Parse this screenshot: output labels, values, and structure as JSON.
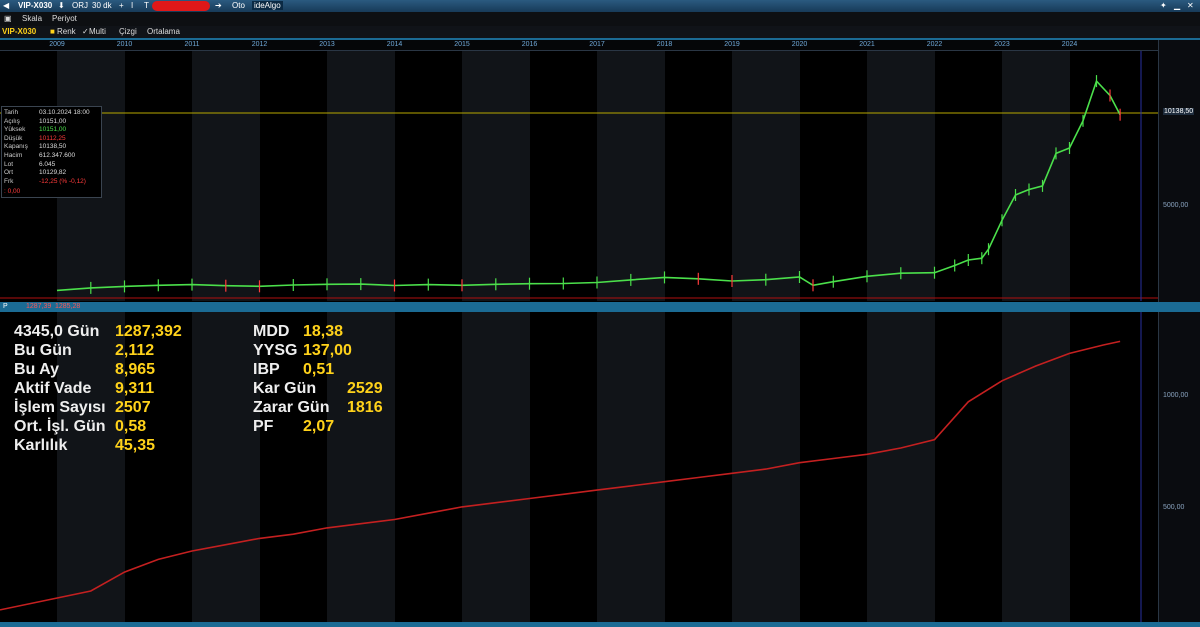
{
  "toolbar": {
    "symbol": "VIP-X030",
    "orj": "ORJ",
    "interval": "30 dk",
    "plus": "+",
    "bar": "I",
    "t": "T",
    "oto": "Oto",
    "brand": "ideAlgo",
    "menu": [
      "Skala",
      "Periyot"
    ]
  },
  "chart_toolbar": {
    "symbol_tag": "VIP-X030",
    "renk": "Renk",
    "multi": "Multi",
    "cizgi": "Çizgi",
    "ortalama": "Ortalama"
  },
  "years": [
    "2009",
    "2010",
    "2011",
    "2012",
    "2013",
    "2014",
    "2015",
    "2016",
    "2017",
    "2018",
    "2019",
    "2020",
    "2021",
    "2022",
    "2023",
    "2024"
  ],
  "info": {
    "rows": [
      {
        "k": "Tarih",
        "v": "03.10.2024 18:00",
        "c": "#ddd"
      },
      {
        "k": "Açılış",
        "v": "10151,00",
        "c": "#ddd"
      },
      {
        "k": "Yüksek",
        "v": "10151,00",
        "c": "#4be04b"
      },
      {
        "k": "Düşük",
        "v": "10112,25",
        "c": "#ff3b3b"
      },
      {
        "k": "Kapanış",
        "v": "10138,50",
        "c": "#ddd"
      },
      {
        "k": "Hacim",
        "v": "612.347.600",
        "c": "#ddd"
      },
      {
        "k": "Lot",
        "v": "6.045",
        "c": "#ddd"
      },
      {
        "k": "Ort",
        "v": "10129,82",
        "c": "#ddd"
      },
      {
        "k": "Frk",
        "v": "-12,25 (% -0,12)",
        "c": "#ff3b3b"
      }
    ],
    "footer": ": 0,00"
  },
  "price_axis": {
    "current": "10138,50",
    "tick": "5000,00"
  },
  "equity_axis": {
    "ticks": [
      "1000,00",
      "500,00"
    ]
  },
  "equity_strip": {
    "label": "P",
    "v1": "1287,39",
    "v2": "1285,28"
  },
  "stats": {
    "left": [
      {
        "label": "4345,0 Gün",
        "value": "1287,392"
      },
      {
        "label": "Bu Gün",
        "value": "2,112"
      },
      {
        "label": "Bu Ay",
        "value": "8,965"
      },
      {
        "label": "Aktif Vade",
        "value": "9,311"
      },
      {
        "label": "İşlem Sayısı",
        "value": "2507"
      },
      {
        "label": "Ort. İşl. Gün",
        "value": "0,58"
      },
      {
        "label": "Karlılık",
        "value": "45,35"
      }
    ],
    "right": [
      {
        "label": "MDD",
        "value": "18,38"
      },
      {
        "label": "YYSG",
        "value": "137,00"
      },
      {
        "label": "IBP",
        "value": "0,51"
      },
      {
        "label": "Kar Gün",
        "value": "2529"
      },
      {
        "label": "Zarar Gün",
        "value": "1816"
      },
      {
        "label": "PF",
        "value": "2,07"
      }
    ]
  },
  "colors": {
    "up": "#4be04b",
    "down": "#ff3b3b",
    "equity": "#c42020",
    "accent": "#1b6b94",
    "stat_value": "#ffd21a"
  },
  "chart_data": [
    {
      "type": "line",
      "series": [
        {
          "x": [
            2009.0,
            2009.5,
            2010.0,
            2010.5,
            2011.0,
            2011.5,
            2012.0,
            2012.5,
            2013.0,
            2013.5,
            2014.0,
            2014.5,
            2015.0,
            2015.5,
            2016.0,
            2016.5,
            2017.0,
            2017.5,
            2018.0,
            2018.5,
            2019.0,
            2019.5,
            2020.0,
            2020.2,
            2020.5,
            2021.0,
            2021.5,
            2022.0,
            2022.3,
            2022.5,
            2022.7,
            2022.8,
            2023.0,
            2023.2,
            2023.4,
            2023.6,
            2023.8,
            2024.0,
            2024.2,
            2024.4,
            2024.6,
            2024.75
          ],
          "values": [
            420,
            560,
            640,
            700,
            740,
            680,
            650,
            720,
            760,
            770,
            690,
            740,
            700,
            760,
            790,
            800,
            860,
            1000,
            1140,
            1060,
            940,
            1010,
            1160,
            700,
            900,
            1200,
            1370,
            1400,
            1800,
            2100,
            2200,
            2700,
            4300,
            5700,
            6000,
            6200,
            8000,
            8300,
            9800,
            12000,
            11200,
            10138
          ]
        }
      ],
      "ylim": [
        0,
        13000
      ]
    },
    {
      "type": "line",
      "series": [
        {
          "x": [
            2009.0,
            2009.5,
            2010.0,
            2010.5,
            2011.0,
            2011.5,
            2012.0,
            2012.5,
            2013.0,
            2013.5,
            2014.0,
            2014.5,
            2015.0,
            2015.5,
            2016.0,
            2016.5,
            2017.0,
            2017.5,
            2018.0,
            2018.5,
            2019.0,
            2019.5,
            2020.0,
            2020.5,
            2021.0,
            2021.5,
            2022.0,
            2022.5,
            2023.0,
            2023.5,
            2024.0,
            2024.5,
            2024.75
          ],
          "values": [
            10,
            100,
            190,
            250,
            290,
            320,
            350,
            370,
            400,
            420,
            440,
            470,
            500,
            520,
            540,
            560,
            580,
            600,
            620,
            640,
            660,
            680,
            710,
            730,
            750,
            780,
            820,
            1000,
            1100,
            1170,
            1230,
            1270,
            1287
          ]
        }
      ],
      "ylim": [
        0,
        1370
      ]
    }
  ]
}
